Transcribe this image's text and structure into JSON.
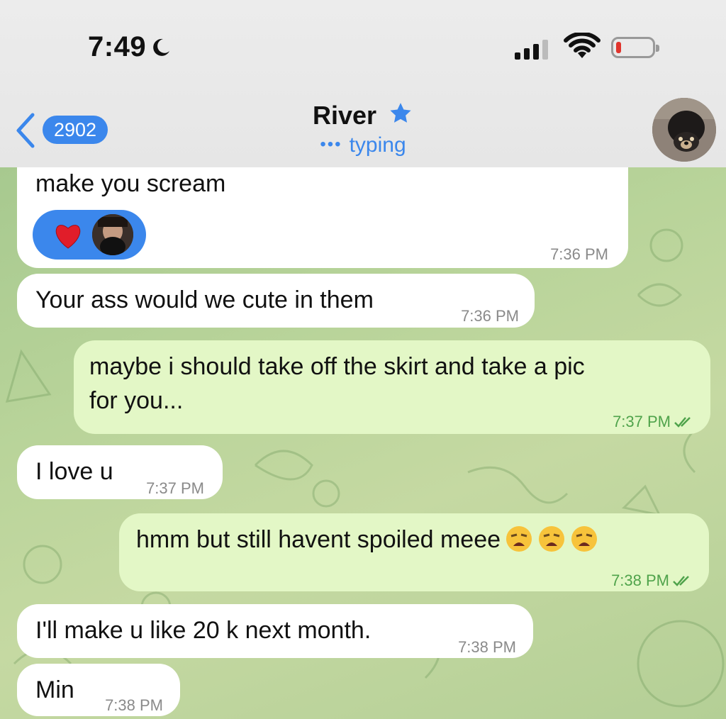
{
  "status_bar": {
    "time": "7:49"
  },
  "header": {
    "back_count": "2902",
    "contact_name": "River",
    "typing_status": "typing"
  },
  "messages": [
    {
      "id": "m1",
      "direction": "incoming",
      "text": "make you scream",
      "time": "7:36 PM",
      "reactions": [
        "heart"
      ]
    },
    {
      "id": "m2",
      "direction": "incoming",
      "text": "Your ass would we cute in them",
      "time": "7:36 PM"
    },
    {
      "id": "m3",
      "direction": "outgoing",
      "text_line1": "maybe i should take off the skirt and take a pic",
      "text_line2": "for you...",
      "time": "7:37 PM",
      "read": true
    },
    {
      "id": "m4",
      "direction": "incoming",
      "text": "I love u",
      "time": "7:37 PM"
    },
    {
      "id": "m5",
      "direction": "outgoing",
      "text": "hmm but still havent spoiled meee",
      "emoji": [
        "weary-face",
        "weary-face",
        "weary-face"
      ],
      "time": "7:38 PM",
      "read": true
    },
    {
      "id": "m6",
      "direction": "incoming",
      "text": "I'll make u like 20 k next month.",
      "time": "7:38 PM"
    },
    {
      "id": "m7",
      "direction": "incoming",
      "text": "Min",
      "time": "7:38 PM"
    }
  ],
  "colors": {
    "accent": "#3b87ec",
    "outgoing_bubble": "#e3f7c6",
    "incoming_bubble": "#ffffff",
    "read_ticks": "#4fa34b"
  }
}
